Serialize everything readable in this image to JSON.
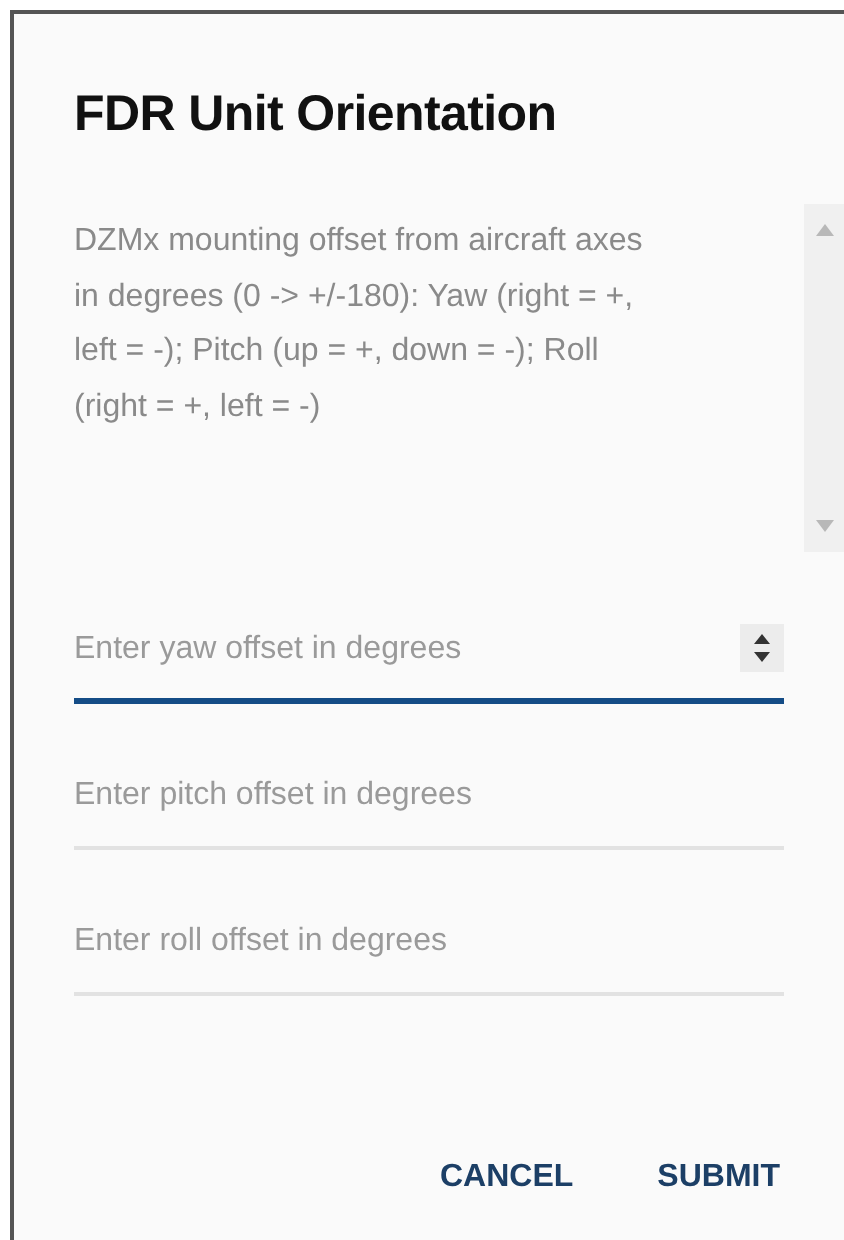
{
  "dialog": {
    "title": "FDR Unit Orientation",
    "description": "DZMx mounting offset from aircraft axes in degrees (0 -> +/-180): Yaw (right = +, left = -); Pitch (up = +, down = -); Roll (right = +, left = -)"
  },
  "fields": [
    {
      "placeholder": "Enter yaw offset in degrees",
      "focused": true
    },
    {
      "placeholder": "Enter pitch offset in degrees",
      "focused": false
    },
    {
      "placeholder": "Enter roll offset in degrees",
      "focused": false
    }
  ],
  "buttons": [
    "CANCEL",
    "SUBMIT"
  ]
}
